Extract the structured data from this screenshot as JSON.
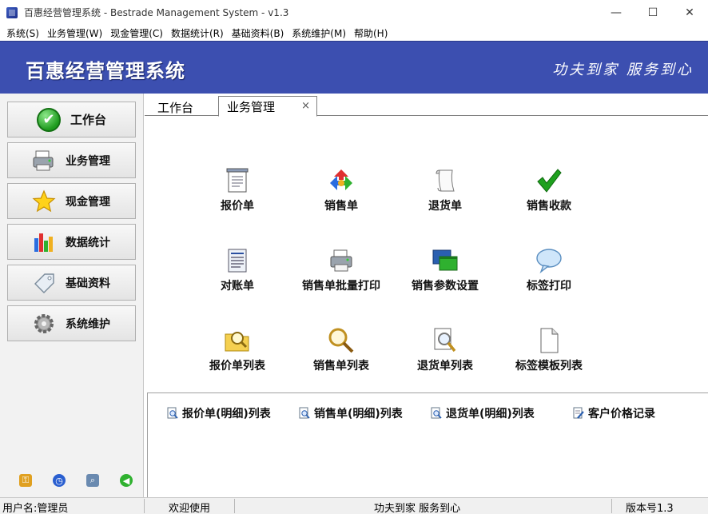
{
  "window": {
    "title": "百惠经营管理系统 - Bestrade Management System - v1.3",
    "controls": [
      "—",
      "☐",
      "✕"
    ]
  },
  "menu": [
    "系统(S)",
    "业务管理(W)",
    "现金管理(C)",
    "数据统计(R)",
    "基础资料(B)",
    "系统维护(M)",
    "帮助(H)"
  ],
  "banner": {
    "title": "百惠经营管理系统",
    "slogan": "功夫到家 服务到心"
  },
  "sidebar": {
    "items": [
      {
        "label": "工作台",
        "icon": "check-icon"
      },
      {
        "label": "业务管理",
        "icon": "printer-icon"
      },
      {
        "label": "现金管理",
        "icon": "star-icon"
      },
      {
        "label": "数据统计",
        "icon": "bar-chart-icon"
      },
      {
        "label": "基础资料",
        "icon": "tag-icon"
      },
      {
        "label": "系统维护",
        "icon": "gear-icon"
      }
    ],
    "tools": [
      "key-icon",
      "clock-icon",
      "search-icon",
      "back-icon"
    ]
  },
  "tabs": {
    "work": "工作台",
    "business": "业务管理",
    "close": "×"
  },
  "grid": [
    {
      "label": "报价单",
      "icon": "document-icon"
    },
    {
      "label": "销售单",
      "icon": "recycle-icon"
    },
    {
      "label": "退货单",
      "icon": "scroll-icon"
    },
    {
      "label": "销售收款",
      "icon": "checkmark-icon"
    },
    {
      "label": "对账单",
      "icon": "ledger-icon"
    },
    {
      "label": "销售单批量打印",
      "icon": "printer-icon"
    },
    {
      "label": "销售参数设置",
      "icon": "windows-icon"
    },
    {
      "label": "标签打印",
      "icon": "speech-bubble-icon"
    },
    {
      "label": "报价单列表",
      "icon": "folder-search-icon"
    },
    {
      "label": "销售单列表",
      "icon": "magnifier-icon"
    },
    {
      "label": "退货单列表",
      "icon": "doc-search-icon"
    },
    {
      "label": "标签模板列表",
      "icon": "blank-page-icon"
    }
  ],
  "links": [
    {
      "label": "报价单(明细)列表",
      "icon": "doc-search-small-icon"
    },
    {
      "label": "销售单(明细)列表",
      "icon": "doc-search-small-icon"
    },
    {
      "label": "退货单(明细)列表",
      "icon": "doc-search-small-icon"
    },
    {
      "label": "客户价格记录",
      "icon": "doc-edit-icon"
    }
  ],
  "status": {
    "user": "用户名:管理员",
    "welcome": "欢迎使用",
    "slogan": "功夫到家 服务到心",
    "version": "版本号1.3"
  },
  "colors": {
    "banner": "#3c4fb0",
    "accent_green": "#1e9b1e"
  }
}
